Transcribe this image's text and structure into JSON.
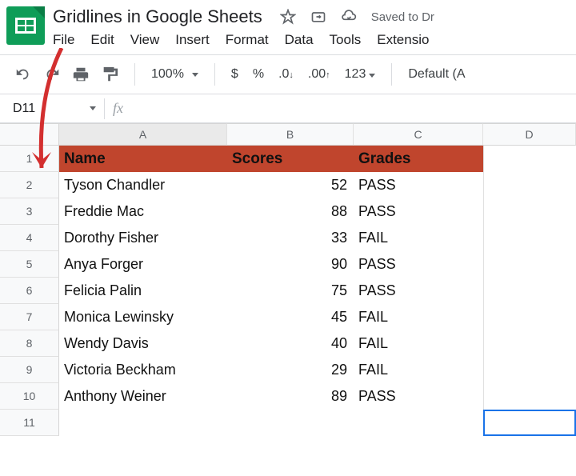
{
  "header": {
    "title": "Gridlines in Google Sheets",
    "saved_text": "Saved to Dr"
  },
  "menu": [
    "File",
    "Edit",
    "View",
    "Insert",
    "Format",
    "Data",
    "Tools",
    "Extensio"
  ],
  "toolbar": {
    "zoom": "100%",
    "currency": "$",
    "percent": "%",
    "dec_minus": ".0",
    "dec_plus": ".00",
    "numfmt": "123",
    "font": "Default (A"
  },
  "name_box": "D11",
  "fx_hint": "fx",
  "columns": [
    "A",
    "B",
    "C",
    "D"
  ],
  "row_nums": [
    "1",
    "2",
    "3",
    "4",
    "5",
    "6",
    "7",
    "8",
    "9",
    "10",
    "11"
  ],
  "table": {
    "headers": {
      "a": "Name",
      "b": "Scores",
      "c": "Grades"
    },
    "rows": [
      {
        "a": "Tyson Chandler",
        "b": "52",
        "c": "PASS"
      },
      {
        "a": "Freddie Mac",
        "b": "88",
        "c": "PASS"
      },
      {
        "a": "Dorothy Fisher",
        "b": "33",
        "c": " FAIL"
      },
      {
        "a": "Anya Forger",
        "b": "90",
        "c": "PASS"
      },
      {
        "a": "Felicia Palin",
        "b": "75",
        "c": "PASS"
      },
      {
        "a": "Monica Lewinsky",
        "b": "45",
        "c": "FAIL"
      },
      {
        "a": "Wendy Davis",
        "b": "40",
        "c": "FAIL"
      },
      {
        "a": "Victoria Beckham",
        "b": "29",
        "c": "FAIL"
      },
      {
        "a": "Anthony Weiner",
        "b": "89",
        "c": "PASS"
      }
    ]
  }
}
